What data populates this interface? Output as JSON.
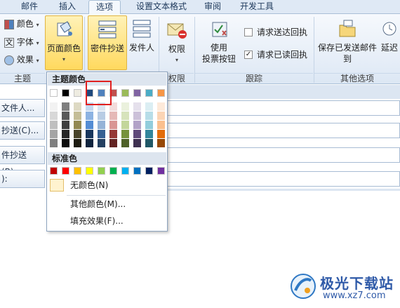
{
  "tabs": [
    "邮件",
    "插入",
    "选项",
    "设置文本格式",
    "审阅",
    "开发工具"
  ],
  "theme_group": {
    "colors": "颜色",
    "fonts": "字体",
    "effects": "效果",
    "label": "主题"
  },
  "page_color_btn": "页面颜色",
  "show_group": {
    "bcc": "密件抄送",
    "from": "发件人"
  },
  "permission": {
    "btn": "权限",
    "label": "权限"
  },
  "tracking": {
    "voting_l1": "使用",
    "voting_l2": "投票按钮",
    "delivery": "请求送达回执",
    "read": "请求已读回执",
    "label": "跟踪"
  },
  "more_options": {
    "save_l1": "保存已发送邮件",
    "save_l2": "到",
    "delay": "延迟",
    "label": "其他选项"
  },
  "form": {
    "to": "文件人...",
    "cc": "抄送(C)...",
    "bcc": "件抄送(B)...",
    "subject": "):"
  },
  "colors": {
    "theme_top": [
      "#ffffff",
      "#000000",
      "#eeece1",
      "#1f497d",
      "#4f81bd",
      "#c0504d",
      "#9bbb59",
      "#8064a2",
      "#4bacc6",
      "#f79646"
    ],
    "theme_shades": [
      [
        "#f2f2f2",
        "#7f7f7f",
        "#ddd9c3",
        "#c6d9f0",
        "#dbe5f1",
        "#f2dcdb",
        "#ebf1dd",
        "#e5e0ec",
        "#dbeef3",
        "#fdeada"
      ],
      [
        "#d8d8d8",
        "#595959",
        "#c4bd97",
        "#8db3e2",
        "#b8cce4",
        "#e5b9b7",
        "#d7e3bc",
        "#ccc1d9",
        "#b7dde8",
        "#fbd5b5"
      ],
      [
        "#bfbfbf",
        "#3f3f3f",
        "#938953",
        "#548dd4",
        "#95b3d7",
        "#d99694",
        "#c3d69b",
        "#b2a2c7",
        "#92cddc",
        "#fac08f"
      ],
      [
        "#a5a5a5",
        "#262626",
        "#494429",
        "#17365d",
        "#366092",
        "#953734",
        "#76923c",
        "#5f497a",
        "#31859b",
        "#e36c09"
      ],
      [
        "#7f7f7f",
        "#0c0c0c",
        "#1d1b10",
        "#0f243e",
        "#244061",
        "#632423",
        "#4f6128",
        "#3f3151",
        "#205867",
        "#974806"
      ]
    ],
    "standard": [
      "#c00000",
      "#ff0000",
      "#ffc000",
      "#ffff00",
      "#92d050",
      "#00b050",
      "#00b0f0",
      "#0070c0",
      "#002060",
      "#7030a0"
    ]
  },
  "popup": {
    "theme_header": "主题颜色",
    "standard_header": "标准色",
    "no_color": "无颜色(N)",
    "more_colors": "其他颜色(M)...",
    "fill_effects": "填充效果(F)..."
  },
  "watermark": {
    "name": "极光下载站",
    "url": "www.xz7.com"
  }
}
